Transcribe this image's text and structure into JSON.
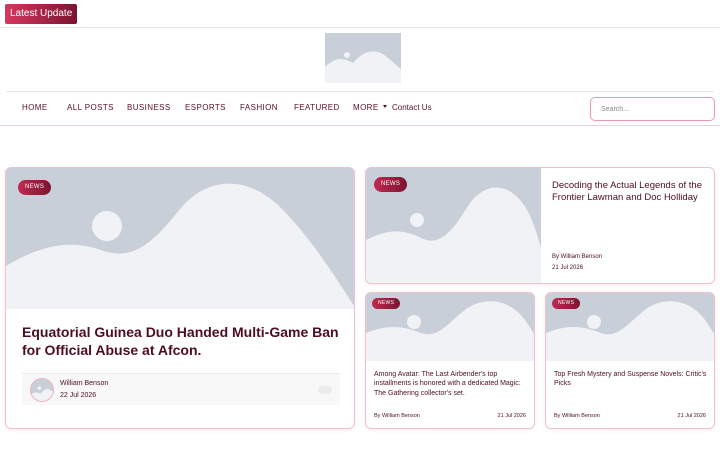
{
  "topbar": {
    "latest_label": "Latest  Update"
  },
  "nav": {
    "items": [
      {
        "label": "HOME"
      },
      {
        "label": "ALL POSTS"
      },
      {
        "label": "BUSINESS"
      },
      {
        "label": "ESPORTS"
      },
      {
        "label": "FASHION"
      },
      {
        "label": "FEATURED"
      },
      {
        "label": "MORE"
      },
      {
        "label": "Contact Us"
      }
    ],
    "search_placeholder": "Search..."
  },
  "posts": {
    "featured": {
      "category": "NEWS",
      "title": "Equatorial Guinea Duo Handed Multi-Game Ban for Official Abuse at Afcon.",
      "author": "William Benson",
      "date": "22 Jul 2026"
    },
    "top_right": {
      "category": "NEWS",
      "title": "Decoding the Actual Legends of the Frontier Lawman and Doc Holliday",
      "byline": "By William Benson",
      "date": "21 Jul 2026"
    },
    "small_1": {
      "category": "NEWS",
      "title": "Among Avatar: The Last Airbender's top installments is honored with a dedicated Magic: The Gathering collector's set.",
      "byline": "By William Benson",
      "date": "21 Jul 2026"
    },
    "small_2": {
      "category": "NEWS",
      "title": "Top Fresh Mystery and Suspense Novels: Critic's Picks",
      "byline": "By William Benson",
      "date": "21 Jul 2026"
    }
  },
  "colors": {
    "accent": "#7a1431",
    "accent_light": "#d8375e",
    "text": "#4f0c21",
    "placeholder_bg": "#c9cfd8",
    "placeholder_fg": "#f1f2f5"
  },
  "icons": {
    "image_placeholder": "image-placeholder-icon",
    "dropdown": "caret-down-icon"
  }
}
